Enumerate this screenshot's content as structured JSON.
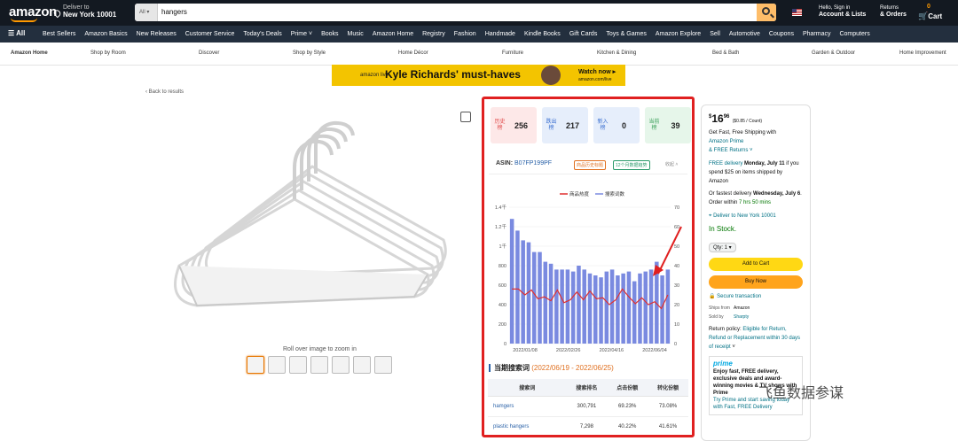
{
  "header": {
    "logo": "amazon",
    "deliver_to_label": "Deliver to",
    "deliver_to_location": "New York 10001",
    "search_category": "All",
    "search_value": "hangers",
    "account_line1": "Hello, Sign in",
    "account_line2": "Account & Lists",
    "returns_line1": "Returns",
    "returns_line2": "& Orders",
    "cart_label": "Cart",
    "cart_count": "0"
  },
  "nav": {
    "all_label": "All",
    "items": [
      "Best Sellers",
      "Amazon Basics",
      "New Releases",
      "Customer Service",
      "Today's Deals",
      "Prime",
      "Books",
      "Music",
      "Amazon Home",
      "Registry",
      "Fashion",
      "Handmade",
      "Kindle Books",
      "Gift Cards",
      "Toys & Games",
      "Amazon Explore",
      "Sell",
      "Automotive",
      "Coupons",
      "Pharmacy",
      "Computers"
    ]
  },
  "subnav": {
    "items": [
      "Amazon Home",
      "Shop by Room",
      "Discover",
      "Shop by Style",
      "Home Décor",
      "Furniture",
      "Kitchen & Dining",
      "Bed & Bath",
      "Garden & Outdoor",
      "Home Improvement"
    ]
  },
  "banner": {
    "brand": "amazon live",
    "headline": "Kyle Richards' must-haves",
    "cta": "Watch now",
    "cta_sub": "amazon.com/live"
  },
  "product": {
    "back_link": "‹ Back to results",
    "zoom_hint": "Roll over image to zoom in"
  },
  "plugin": {
    "cards": [
      {
        "label": "历史榜",
        "value": "256",
        "bg": "#fde8e8",
        "fg": "#e04848"
      },
      {
        "label": "跌出榜",
        "value": "217",
        "bg": "#e6eefb",
        "fg": "#3a6fd0"
      },
      {
        "label": "新入榜",
        "value": "0",
        "bg": "#e6eefb",
        "fg": "#3a6fd0"
      },
      {
        "label": "当前榜",
        "value": "39",
        "bg": "#e6f6ea",
        "fg": "#3aa05a"
      }
    ],
    "asin_label": "ASIN:",
    "asin_value": "B07FP199PF",
    "tag_history": "商品历史标题",
    "tag_trend": "12个月数据趋势",
    "collapse": "收起",
    "current_title": "当期搜索词",
    "current_range": "(2022/06/19 - 2022/06/25)",
    "table_headers": [
      "搜索词",
      "搜索排名",
      "点击份额",
      "转化份额"
    ],
    "table_rows": [
      [
        "hamgers",
        "300,791",
        "69.23%",
        "73.08%"
      ],
      [
        "plastic hangers",
        "7,298",
        "40.22%",
        "41.61%"
      ]
    ]
  },
  "chart_data": {
    "type": "bar",
    "legend": [
      "商品热度",
      "搜索词数"
    ],
    "legend_position": "top",
    "left_axis_ticks": [
      "1.4千",
      "1.2千",
      "1千",
      "800",
      "600",
      "400",
      "200",
      "0"
    ],
    "right_axis_ticks": [
      "70",
      "60",
      "50",
      "40",
      "30",
      "20",
      "10",
      "0"
    ],
    "left_ylim": [
      0,
      1400
    ],
    "right_ylim": [
      0,
      70
    ],
    "x_tick_labels": [
      "2022/01/08",
      "2022/02/26",
      "2022/04/16",
      "2022/06/04"
    ],
    "series": [
      {
        "name": "商品热度",
        "type": "line",
        "color": "#e03030",
        "values": [
          560,
          560,
          500,
          550,
          460,
          480,
          440,
          550,
          420,
          450,
          530,
          450,
          540,
          460,
          470,
          400,
          450,
          560,
          480,
          410,
          470,
          400,
          430,
          360,
          500
        ]
      },
      {
        "name": "搜索词数",
        "type": "bar",
        "axis": "right",
        "color": "#7a8ae0",
        "values": [
          64,
          58,
          53,
          52,
          47,
          47,
          42,
          41,
          38,
          38,
          38,
          37,
          40,
          38,
          36,
          35,
          34,
          37,
          38,
          35,
          36,
          37,
          32,
          36,
          37,
          38,
          42,
          35,
          38
        ]
      }
    ],
    "grid": true
  },
  "buybox": {
    "price_whole": "16",
    "price_frac": "96",
    "unit_price": "($0.85 / Count)",
    "shipping_line1": "Get Fast, Free Shipping with",
    "prime_link": "Amazon Prime",
    "free_returns": "& FREE Returns",
    "free_delivery": "FREE delivery",
    "delivery_date": "Monday, July 11",
    "delivery_cond": "if you spend $25 on items shipped by Amazon",
    "fastest_label": "Or fastest delivery",
    "fastest_date": "Wednesday, July 6",
    "order_within": "Order within",
    "countdown": "7 hrs 50 mins",
    "location": "Deliver to New York 10001",
    "stock": "In Stock.",
    "qty": "Qty: 1",
    "add_to_cart": "Add to Cart",
    "buy_now": "Buy Now",
    "secure": "Secure transaction",
    "ships_from_label": "Ships from",
    "ships_from_value": "Amazon",
    "sold_by_label": "Sold by",
    "sold_by_value": "Sharpty",
    "return_policy_label": "Return policy:",
    "return_policy_value": "Eligible for Return, Refund or Replacement within 30 days of receipt",
    "prime_badge": "prime",
    "prime_text": "Enjoy fast, FREE delivery, exclusive deals and award-winning movies & TV shows with Prime",
    "prime_try": "Try Prime and start saving today with Fast, FREE Delivery"
  },
  "watermark": "飞鱼数据参谋"
}
